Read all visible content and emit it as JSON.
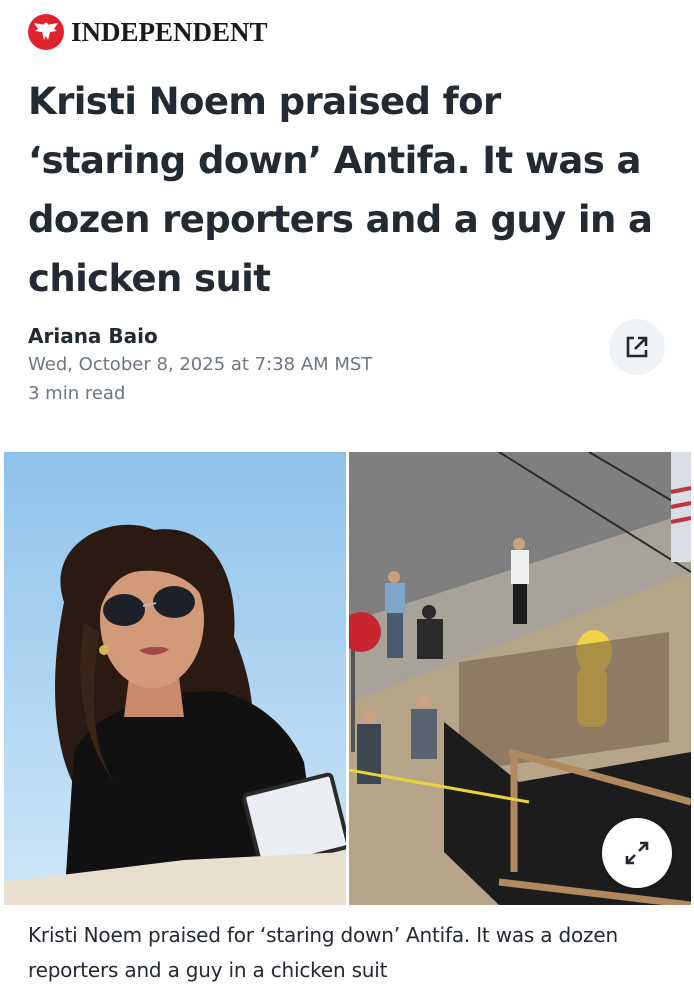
{
  "publication": {
    "name": "INDEPENDENT",
    "logo_icon": "eagle-icon",
    "brand_color": "#e0232d"
  },
  "article": {
    "headline": "Kristi Noem praised for ‘staring down’ Antifa. It was a dozen reporters and a guy in a chicken suit",
    "author": "Ariana Baio",
    "date": "Wed, October 8, 2025 at 7:38 AM MST",
    "read_time": "3 min read",
    "caption": "Kristi Noem praised for ‘staring down’ Antifa. It was a dozen reporters and a guy in a chicken suit"
  },
  "actions": {
    "share_icon": "external-link-icon",
    "expand_icon": "expand-icon"
  },
  "colors": {
    "text": "#232a31",
    "meta_text": "#6e7780",
    "button_bg": "#f0f3f5"
  }
}
